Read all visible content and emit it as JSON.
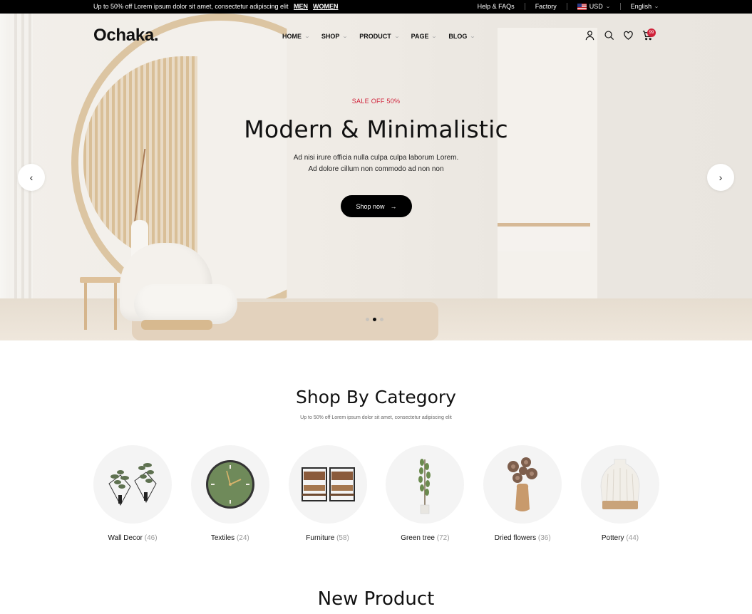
{
  "topbar": {
    "promo": "Up to 50% off Lorem ipsum dolor sit amet, consectetur adipiscing elit",
    "men": "MEN",
    "women": "WOMEN",
    "help": "Help & FAQs",
    "factory": "Factory",
    "currency": "USD",
    "language": "English"
  },
  "header": {
    "logo": "Ochaka.",
    "nav": [
      "HOME",
      "SHOP",
      "PRODUCT",
      "PAGE",
      "BLOG"
    ],
    "cart_count": "99"
  },
  "hero": {
    "sale": "SALE OFF 50%",
    "title": "Modern & Minimalistic",
    "desc_line1": "Ad nisi irure officia nulla culpa culpa laborum Lorem.",
    "desc_line2": "Ad dolore cillum non commodo ad non non",
    "button": "Shop now",
    "slides_total": 3,
    "active_slide": 2
  },
  "categories": {
    "title": "Shop By Category",
    "subtitle": "Up to 50% off Lorem ipsum dolor sit amet, consectetur adipiscing elit",
    "items": [
      {
        "name": "Wall Decor",
        "count": "(46)"
      },
      {
        "name": "Textiles",
        "count": "(24)"
      },
      {
        "name": "Furniture",
        "count": "(58)"
      },
      {
        "name": "Green tree",
        "count": "(72)"
      },
      {
        "name": "Dried flowers",
        "count": "(36)"
      },
      {
        "name": "Pottery",
        "count": "(44)"
      }
    ]
  },
  "new_product": {
    "title": "New Product"
  },
  "colors": {
    "accent": "#d0223a",
    "primary": "#000000"
  }
}
